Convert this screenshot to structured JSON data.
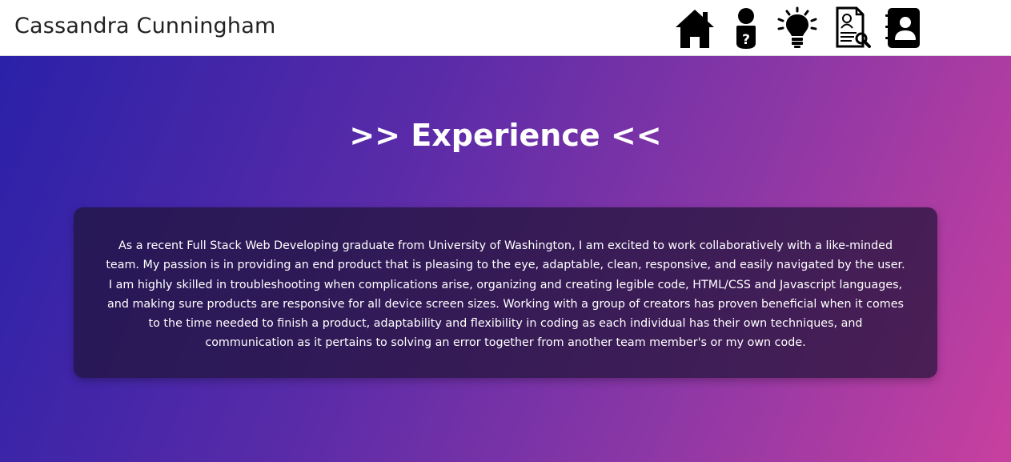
{
  "header": {
    "brand": "Cassandra Cunningham",
    "nav": [
      {
        "icon": "home-icon"
      },
      {
        "icon": "about-me-icon"
      },
      {
        "icon": "lightbulb-icon"
      },
      {
        "icon": "resume-icon"
      },
      {
        "icon": "contact-icon"
      }
    ]
  },
  "main": {
    "title": ">> Experience <<",
    "description": "As a recent Full Stack Web Developing graduate from University of Washington, I am excited to work collaboratively with a like-minded team. My passion is in providing an end product that is pleasing to the eye, adaptable, clean, responsive, and easily navigated by the user. I am highly skilled in troubleshooting when complications arise, organizing and creating legible code, HTML/CSS and Javascript languages, and making sure products are responsive for all device screen sizes. Working with a group of creators has proven beneficial when it comes to the time needed to finish a product, adaptability and flexibility in coding as each individual has their own techniques, and communication as it pertains to solving an error together from another team member's or my own code."
  },
  "colors": {
    "gradient_start": "#2a21a8",
    "gradient_end": "#c8409f",
    "card_background": "#201437",
    "text": "#ffffff"
  }
}
